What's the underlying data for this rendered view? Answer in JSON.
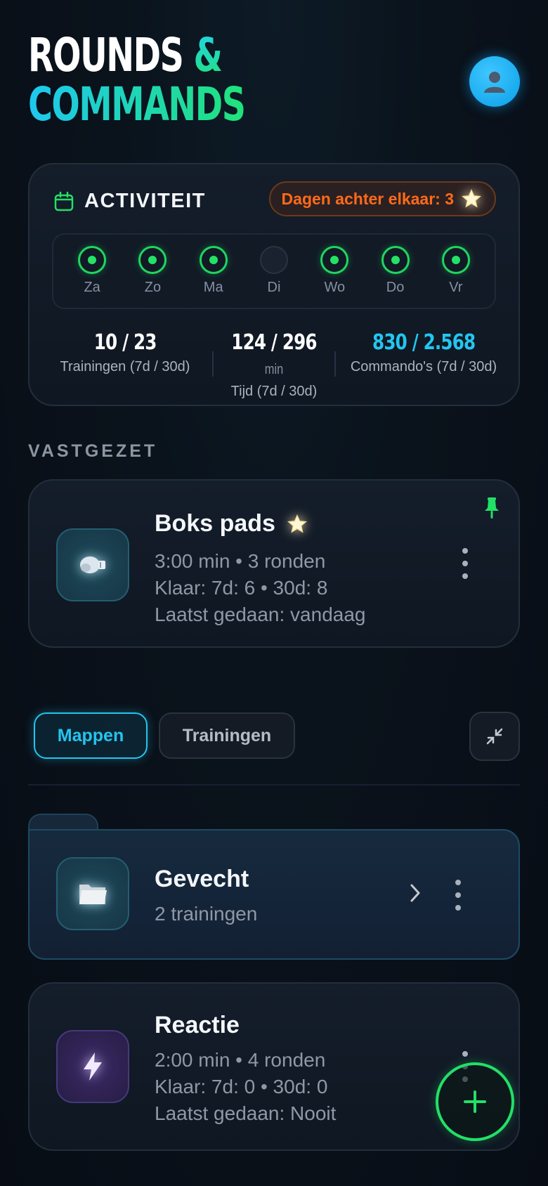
{
  "header": {
    "title_line1": "ROUNDS",
    "title_amp": "&",
    "title_line2": "COMMANDS",
    "avatar_icon": "user-icon"
  },
  "activity": {
    "title": "ACTIVITEIT",
    "streak_label": "Dagen achter elkaar: 3",
    "days": [
      {
        "label": "Za",
        "done": true
      },
      {
        "label": "Zo",
        "done": true
      },
      {
        "label": "Ma",
        "done": true
      },
      {
        "label": "Di",
        "done": false
      },
      {
        "label": "Wo",
        "done": true
      },
      {
        "label": "Do",
        "done": true
      },
      {
        "label": "Vr",
        "done": true
      }
    ],
    "stats": [
      {
        "value": "10 / 23",
        "unit": "",
        "label": "Trainingen (7d / 30d)"
      },
      {
        "value": "124 / 296",
        "unit": "min",
        "label": "Tijd (7d / 30d)"
      },
      {
        "value": "830 / 2.568",
        "unit": "",
        "label": "Commando's (7d / 30d)"
      }
    ]
  },
  "pinned": {
    "section_label": "VASTGEZET",
    "name": "Boks pads",
    "meta_line1": "3:00 min • 3 ronden",
    "meta_line2": "Klaar: 7d: 6 • 30d: 8",
    "meta_line3": "Laatst gedaan: vandaag"
  },
  "tabs": {
    "folders": "Mappen",
    "trainings": "Trainingen"
  },
  "folder": {
    "name": "Gevecht",
    "count": "2 trainingen"
  },
  "training": {
    "name": "Reactie",
    "meta_line1": "2:00 min • 4 ronden",
    "meta_line2": "Klaar: 7d: 0 • 30d: 0",
    "meta_line3": "Laatst gedaan: Nooit"
  },
  "colors": {
    "accent_green": "#22e067",
    "accent_cyan": "#23c5ef",
    "streak_orange": "#ff6a1a"
  }
}
